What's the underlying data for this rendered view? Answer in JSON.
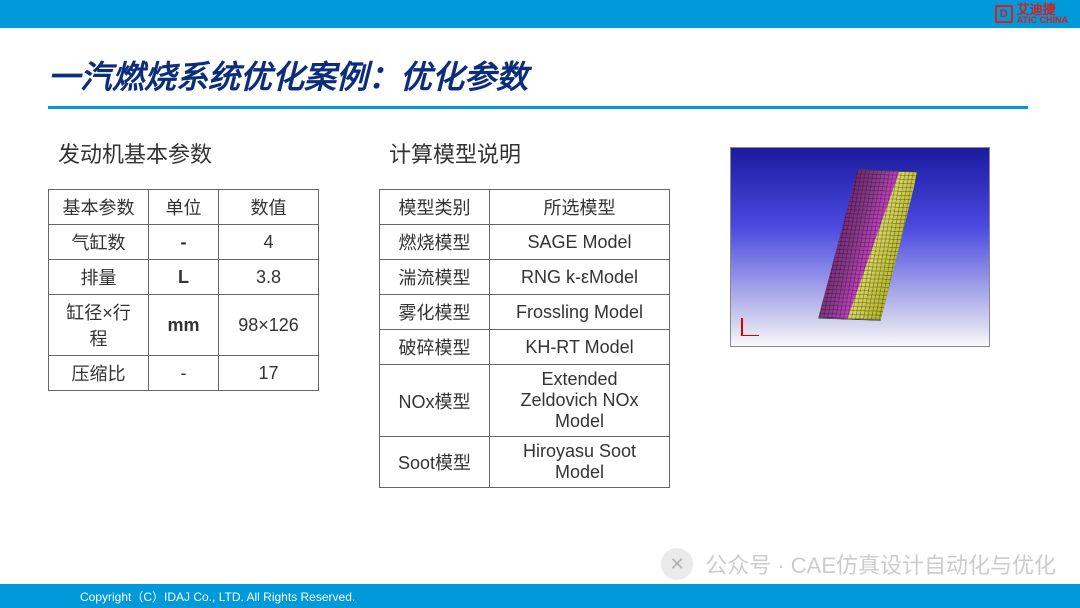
{
  "brand": {
    "cn": "艾迪捷",
    "en": "ATIC CHINA",
    "mark": "D"
  },
  "title": "一汽燃烧系统优化案例：优化参数",
  "section1": {
    "heading": "发动机基本参数",
    "header": [
      "基本参数",
      "单位",
      "数值"
    ],
    "rows": [
      [
        "气缸数",
        "-",
        "4"
      ],
      [
        "排量",
        "L",
        "3.8"
      ],
      [
        "缸径×行程",
        "mm",
        "98×126"
      ],
      [
        "压缩比",
        "-",
        "17"
      ]
    ]
  },
  "section2": {
    "heading": "计算模型说明",
    "header": [
      "模型类别",
      "所选模型"
    ],
    "rows": [
      [
        "燃烧模型",
        "SAGE Model"
      ],
      [
        "湍流模型",
        "RNG  k-εModel"
      ],
      [
        "雾化模型",
        "Frossling Model"
      ],
      [
        "破碎模型",
        "KH-RT Model"
      ],
      [
        "NOx模型",
        "Extended Zeldovich NOx Model"
      ],
      [
        "Soot模型",
        "Hiroyasu Soot Model"
      ]
    ]
  },
  "footer": "Copyright（C）IDAJ Co., LTD. All Rights Reserved.",
  "watermark": "公众号 · CAE仿真设计自动化与优化"
}
